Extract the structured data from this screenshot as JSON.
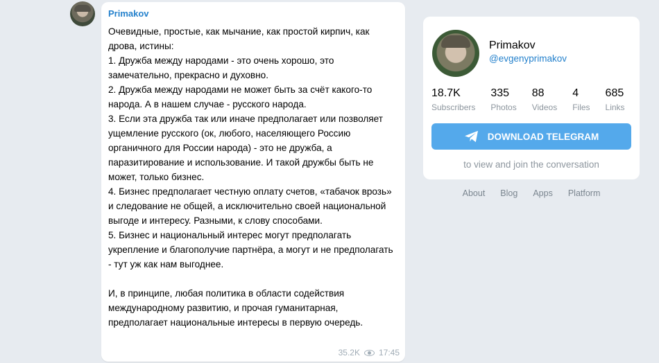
{
  "post": {
    "author": "Primakov",
    "text": "Очевидные, простые, как мычание, как простой кирпич, как дрова, истины:\n1. Дружба между народами - это очень хорошо, это замечательно, прекрасно и духовно.\n2. Дружба между народами не может быть за счёт какого-то народа. А в нашем случае - русского народа.\n3. Если эта дружба так или иначе предполагает или позволяет ущемление русского (ок, любого, населяющего Россию органичного для России народа) - это не дружба, а паразитирование и использование. И такой дружбы быть не может, только бизнес.\n4. Бизнес предполагает честную оплату счетов, «табачок врозь» и следование не общей, а исключительно своей национальной выгоде и интересу. Разными, к слову способами.\n5. Бизнес и национальный интерес могут предполагать укрепление и благополучие партнёра, а могут и не предполагать - тут уж как нам выгоднее.\n\nИ, в принципе, любая политика в области содействия международному развитию, и прочая гуманитарная, предполагает национальные интересы в первую очередь.",
    "views": "35.2K",
    "time": "17:45"
  },
  "channel": {
    "name": "Primakov",
    "handle": "@evgenyprimakov",
    "stats": [
      {
        "value": "18.7K",
        "label": "Subscribers"
      },
      {
        "value": "335",
        "label": "Photos"
      },
      {
        "value": "88",
        "label": "Videos"
      },
      {
        "value": "4",
        "label": "Files"
      },
      {
        "value": "685",
        "label": "Links"
      }
    ],
    "download_label": "DOWNLOAD TELEGRAM",
    "join_text": "to view and join the conversation"
  },
  "footer": {
    "links": [
      "About",
      "Blog",
      "Apps",
      "Platform"
    ]
  },
  "colors": {
    "accent": "#2481cc",
    "button": "#54a9eb",
    "background": "#e7ebf0"
  }
}
